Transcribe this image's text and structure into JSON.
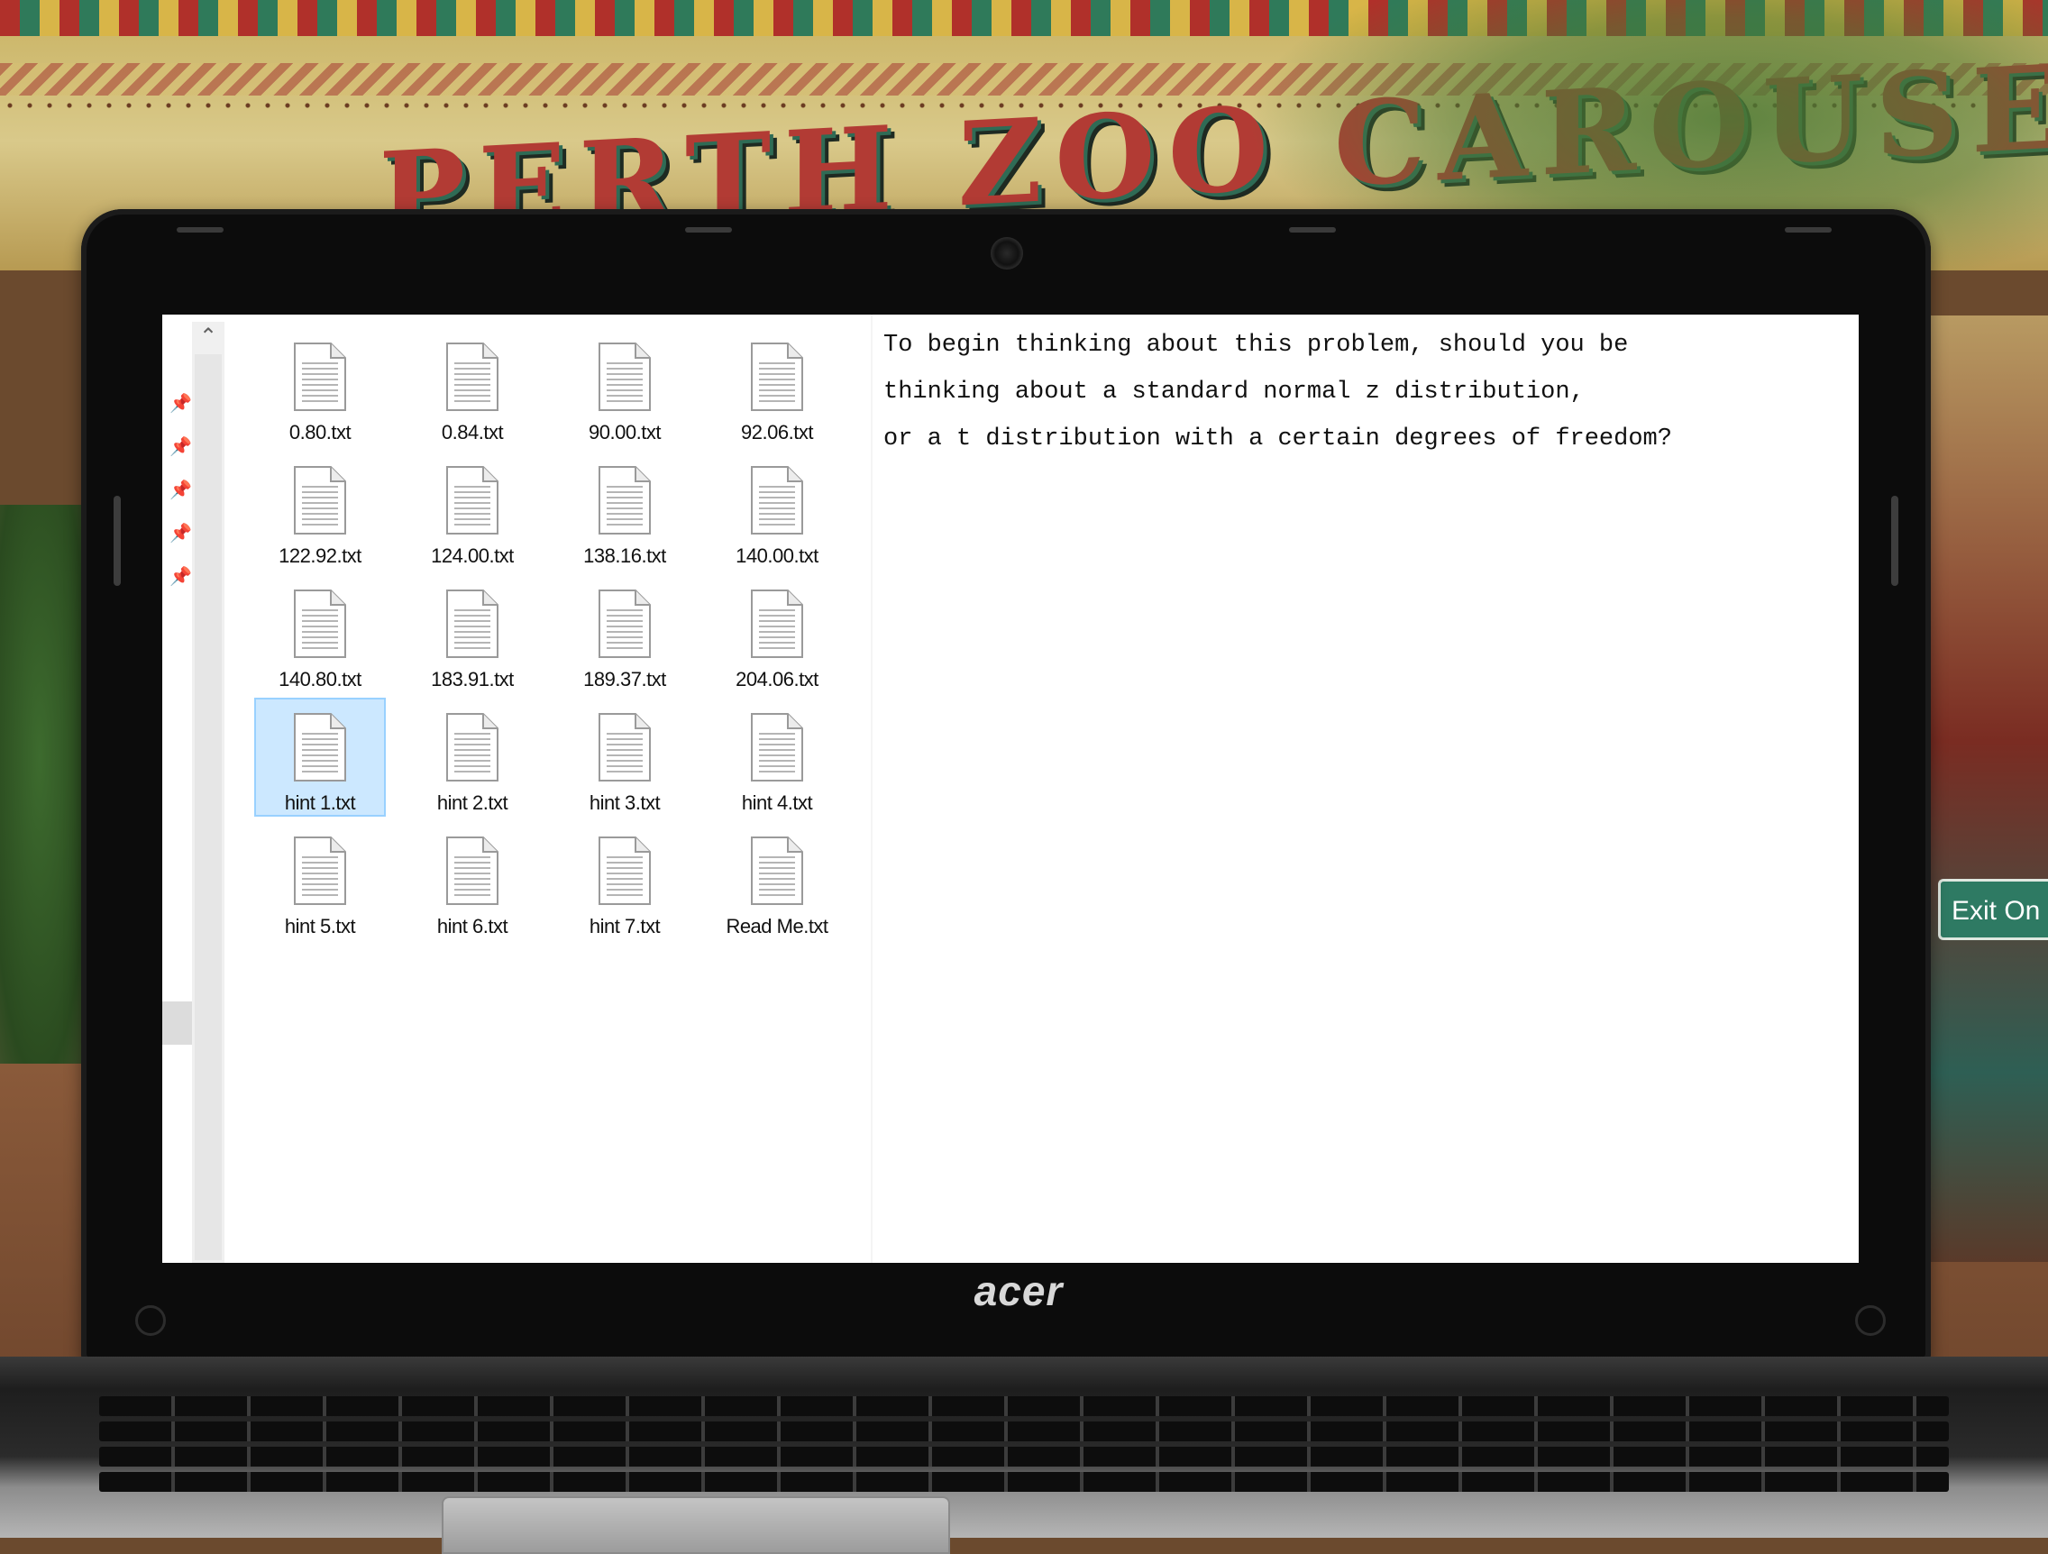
{
  "background": {
    "sign_text": "PERTH ZOO CAROUSEL",
    "exit_sign": "Exit On"
  },
  "laptop": {
    "brand": "acer"
  },
  "explorer": {
    "scroll_up_glyph": "^",
    "pinned_count": 5,
    "files": [
      {
        "name": "0.80.txt"
      },
      {
        "name": "0.84.txt"
      },
      {
        "name": "90.00.txt"
      },
      {
        "name": "92.06.txt"
      },
      {
        "name": "122.92.txt"
      },
      {
        "name": "124.00.txt"
      },
      {
        "name": "138.16.txt"
      },
      {
        "name": "140.00.txt"
      },
      {
        "name": "140.80.txt"
      },
      {
        "name": "183.91.txt"
      },
      {
        "name": "189.37.txt"
      },
      {
        "name": "204.06.txt"
      },
      {
        "name": "hint 1.txt",
        "selected": true
      },
      {
        "name": "hint 2.txt"
      },
      {
        "name": "hint 3.txt"
      },
      {
        "name": "hint 4.txt"
      },
      {
        "name": "hint 5.txt"
      },
      {
        "name": "hint 6.txt"
      },
      {
        "name": "hint 7.txt"
      },
      {
        "name": "Read Me.txt"
      }
    ]
  },
  "reading_pane": {
    "lines": [
      "To begin thinking about this problem, should you be",
      "thinking about a standard normal z distribution,",
      "or a t distribution with a certain degrees of freedom?"
    ]
  },
  "colors": {
    "selection_fill": "#cce8ff",
    "selection_border": "#99d1ff"
  }
}
